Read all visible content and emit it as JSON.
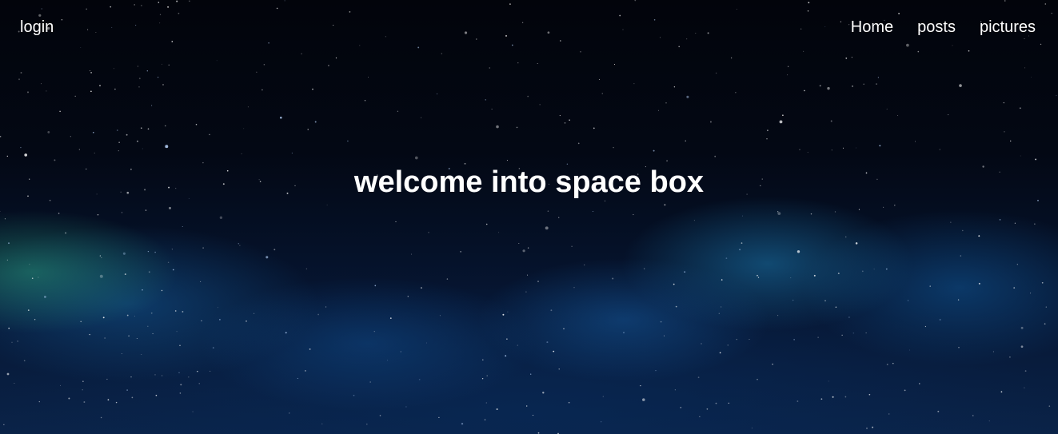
{
  "nav": {
    "login_label": "login",
    "links": [
      {
        "label": "Home"
      },
      {
        "label": "posts"
      },
      {
        "label": "pictures"
      }
    ]
  },
  "hero": {
    "headline": "welcome into space box"
  },
  "colors": {
    "text": "#ffffff",
    "sky_dark": "#02050c",
    "nebula_blue": "#1f6fa8",
    "nebula_green": "#2e9a78"
  }
}
